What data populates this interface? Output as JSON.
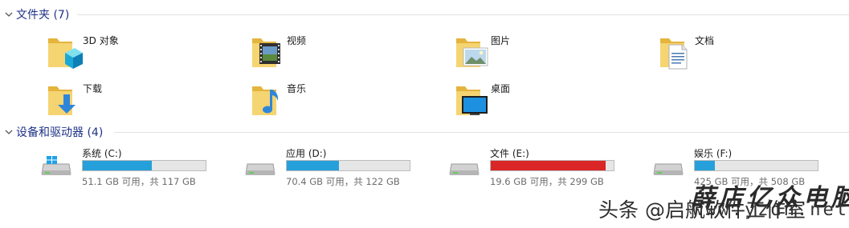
{
  "groups": {
    "folders": {
      "title": "文件夹 (7)",
      "items": [
        {
          "name": "3D 对象",
          "icon": "folder-3d-objects-icon"
        },
        {
          "name": "视频",
          "icon": "folder-videos-icon"
        },
        {
          "name": "图片",
          "icon": "folder-pictures-icon"
        },
        {
          "name": "文档",
          "icon": "folder-documents-icon"
        },
        {
          "name": "下载",
          "icon": "folder-downloads-icon"
        },
        {
          "name": "音乐",
          "icon": "folder-music-icon"
        },
        {
          "name": "桌面",
          "icon": "folder-desktop-icon"
        }
      ]
    },
    "drives": {
      "title": "设备和驱动器 (4)",
      "items": [
        {
          "name": "系统 (C:)",
          "free": "51.1 GB 可用，共 117 GB",
          "used_fraction": 0.563,
          "bar_color": "#26a0da",
          "icon": "windows-drive-icon"
        },
        {
          "name": "应用 (D:)",
          "free": "70.4 GB 可用，共 122 GB",
          "used_fraction": 0.423,
          "bar_color": "#26a0da",
          "icon": "hard-drive-icon"
        },
        {
          "name": "文件 (E:)",
          "free": "19.6 GB 可用，共 299 GB",
          "used_fraction": 0.934,
          "bar_color": "#da2626",
          "icon": "hard-drive-icon"
        },
        {
          "name": "娱乐 (F:)",
          "free": "425 GB 可用，共 508 GB",
          "used_fraction": 0.163,
          "bar_color": "#26a0da",
          "icon": "hard-drive-icon"
        }
      ]
    }
  },
  "watermark": "头条 @启航软件工作室",
  "overlay": {
    "text_cn": "薛店亿众电脑",
    "url": "www.yzdn.net"
  },
  "colors": {
    "group_title": "#1e3287",
    "bar_normal": "#26a0da",
    "bar_full": "#da2626"
  }
}
